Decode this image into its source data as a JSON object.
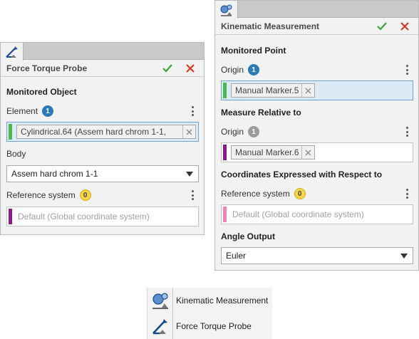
{
  "left_panel": {
    "tab_icon": "force-torque-probe-icon",
    "title": "Force Torque Probe",
    "section": "Monitored Object",
    "element_label": "Element",
    "element_count": "1",
    "element_value": "Cylindrical.64 (Assem hard chrom 1-1,",
    "body_label": "Body",
    "body_value": "Assem hard chrom 1-1",
    "ref_label": "Reference system",
    "ref_count": "0",
    "ref_placeholder": "Default (Global coordinate system)"
  },
  "right_panel": {
    "tab_icon": "kinematic-measurement-icon",
    "title": "Kinematic Measurement",
    "section_point": "Monitored Point",
    "origin_label": "Origin",
    "origin_count": "1",
    "origin_value": "Manual Marker.5",
    "section_relative": "Measure Relative to",
    "rel_origin_label": "Origin",
    "rel_origin_count": "1",
    "rel_origin_value": "Manual Marker.6",
    "section_coords": "Coordinates Expressed with Respect to",
    "ref_label": "Reference system",
    "ref_count": "0",
    "ref_placeholder": "Default (Global coordinate system)",
    "section_angle": "Angle Output",
    "angle_value": "Euler"
  },
  "palette": {
    "items": [
      {
        "label": "Kinematic Measurement",
        "icon": "kinematic-measurement-icon"
      },
      {
        "label": "Force Torque Probe",
        "icon": "force-torque-probe-icon"
      }
    ]
  },
  "colors": {
    "accept": "#3aa63a",
    "cancel": "#d23a2a",
    "bar_green": "#4cb849",
    "bar_purple": "#8c1a8c",
    "bar_pink": "#ef85b4",
    "badge_blue": "#2a7ab8"
  }
}
